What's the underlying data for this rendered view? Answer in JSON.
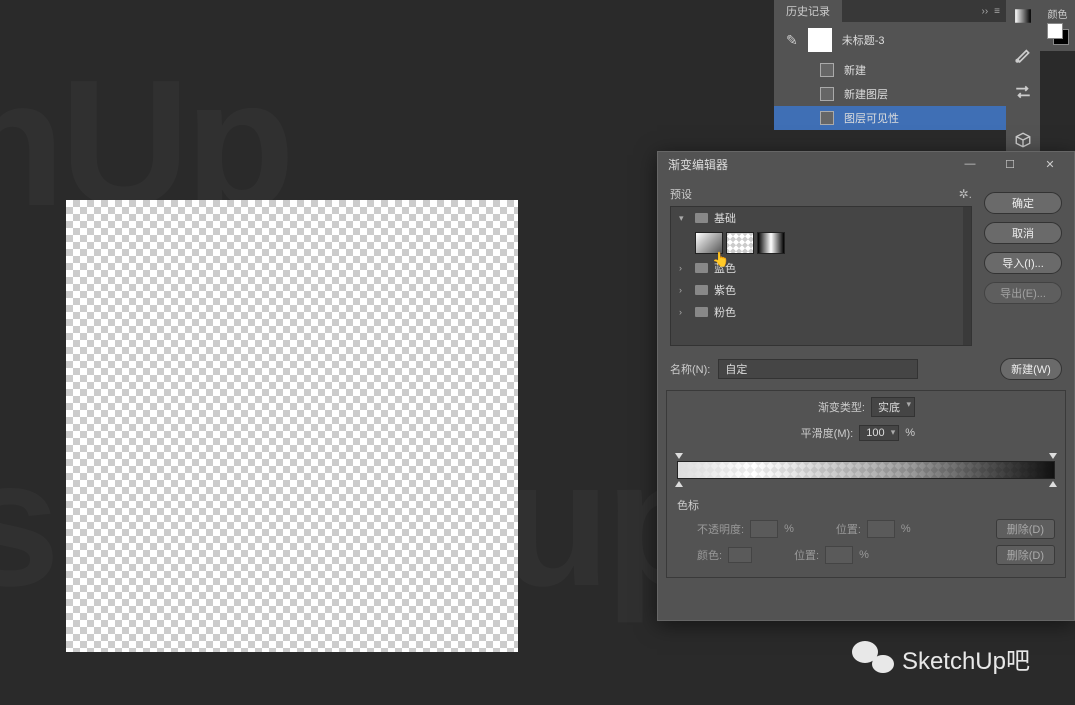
{
  "history": {
    "tab": "历史记录",
    "doc_name": "未标题-3",
    "items": [
      {
        "label": "新建"
      },
      {
        "label": "新建图层"
      },
      {
        "label": "图层可见性"
      }
    ]
  },
  "dialog": {
    "title": "渐变编辑器",
    "presets_label": "预设",
    "folders": {
      "basics": "基础",
      "blue": "蓝色",
      "purple": "紫色",
      "pink": "粉色"
    },
    "name_label": "名称(N):",
    "name_value": "自定",
    "grad_type_label": "渐变类型:",
    "grad_type_value": "实底",
    "smoothness_label": "平滑度(M):",
    "smoothness_value": "100",
    "percent": "%",
    "stops_header": "色标",
    "opacity_label": "不透明度:",
    "position_label": "位置:",
    "color_label": "颜色:",
    "buttons": {
      "ok": "确定",
      "cancel": "取消",
      "import": "导入(I)...",
      "export": "导出(E)...",
      "new": "新建(W)",
      "delete": "删除(D)"
    }
  },
  "watermark": {
    "brand": "SketchUp吧"
  }
}
